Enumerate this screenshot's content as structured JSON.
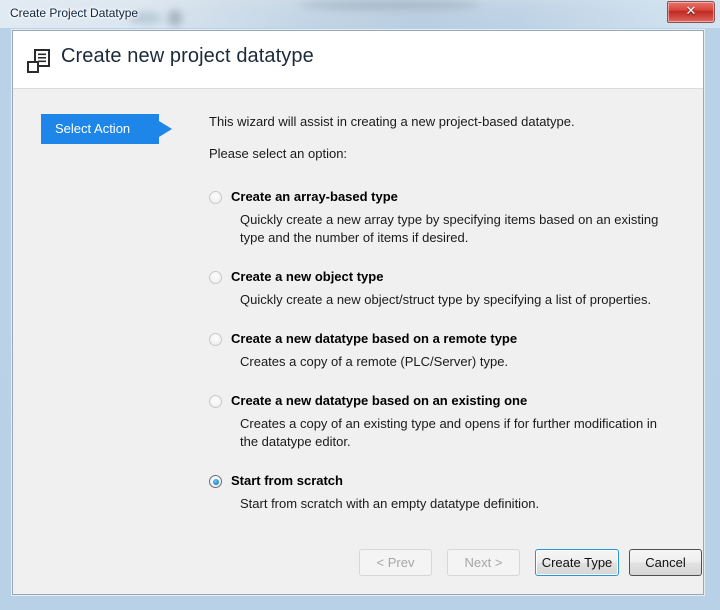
{
  "window": {
    "title": "Create Project Datatype",
    "close_label": "✕",
    "close_icon": "close-icon"
  },
  "header": {
    "icon": "datatype-struct-icon",
    "title": "Create new project datatype"
  },
  "steps": [
    {
      "label": "Select Action",
      "active": true
    }
  ],
  "main": {
    "intro_line1": "This wizard will assist in creating a new project-based datatype.",
    "intro_line2": "Please select an option:",
    "options": [
      {
        "title": "Create an array-based type",
        "description": "Quickly create a new array type by specifying items based on an existing type and the number of items if desired.",
        "selected": false
      },
      {
        "title": "Create a new object type",
        "description": "Quickly create a new object/struct type by specifying a list of properties.",
        "selected": false
      },
      {
        "title": "Create a new datatype based on a remote type",
        "description": "Creates a copy of a remote (PLC/Server) type.",
        "selected": false
      },
      {
        "title": "Create a new datatype based on an existing one",
        "description": "Creates a copy of an existing type and opens if for further modification in the datatype editor.",
        "selected": false
      },
      {
        "title": "Start from scratch",
        "description": "Start from scratch with an empty datatype definition.",
        "selected": true
      }
    ]
  },
  "footer": {
    "prev_label": "< Prev",
    "next_label": "Next >",
    "create_label": "Create Type",
    "cancel_label": "Cancel"
  },
  "colors": {
    "accent_blue": "#1e86e8",
    "focus_blue": "#2596d6",
    "close_red": "#d9453c",
    "body_grey": "#f0f0f0"
  }
}
